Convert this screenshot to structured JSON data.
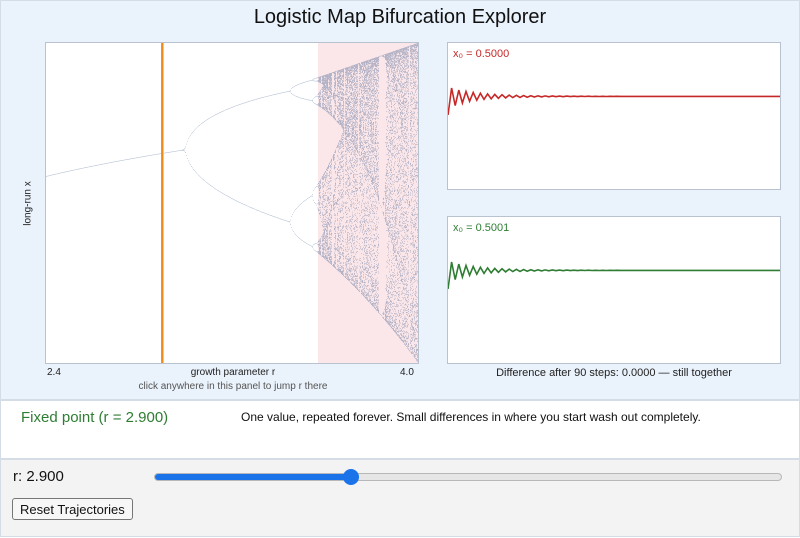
{
  "app": {
    "title": "Logistic Map Bifurcation Explorer"
  },
  "colors": {
    "accent": "#1a73e8",
    "marker": "#ef8a17",
    "chaos_band": "#fbe7e9",
    "bifurcation_points": "#3f5f8f",
    "series_a": "#c62828",
    "series_b": "#2e7d32",
    "state": "#2e7d32"
  },
  "bifurcation": {
    "ylabel": "long-run x",
    "xlabel": "growth parameter r",
    "x_min_label": "2.4",
    "x_max_label": "4.0",
    "hint": "click anywhere in this panel to jump r there"
  },
  "trajectory_a": {
    "label": "x₀ = 0.5000"
  },
  "trajectory_b": {
    "label": "x₀ = 0.5001"
  },
  "difference": {
    "text": "Difference after 90 steps: 0.0000  — still together"
  },
  "state": {
    "name": "Fixed point  (r = 2.900)",
    "description": "One value, repeated forever. Small differences in where you start wash out completely."
  },
  "controls": {
    "r_label": "r: 2.900",
    "r_value": 2.9,
    "r_min": 2.4,
    "r_max": 4.0,
    "reset_label": "Reset Trajectories"
  },
  "chart_data": [
    {
      "type": "scatter",
      "xlabel": "growth parameter r",
      "ylabel": "long-run x",
      "xlim": [
        2.4,
        4.0
      ],
      "ylim": [
        0,
        1
      ],
      "marker_r": 2.9,
      "chaos_band_r": [
        3.57,
        4.0
      ]
    },
    {
      "type": "line",
      "series": [
        {
          "name": "x₀ = 0.5000",
          "x0": 0.5,
          "r": 2.9,
          "steps": 90
        }
      ],
      "ylim": [
        0,
        1
      ]
    },
    {
      "type": "line",
      "series": [
        {
          "name": "x₀ = 0.5001",
          "x0": 0.5001,
          "r": 2.9,
          "steps": 90
        }
      ],
      "ylim": [
        0,
        1
      ]
    }
  ]
}
